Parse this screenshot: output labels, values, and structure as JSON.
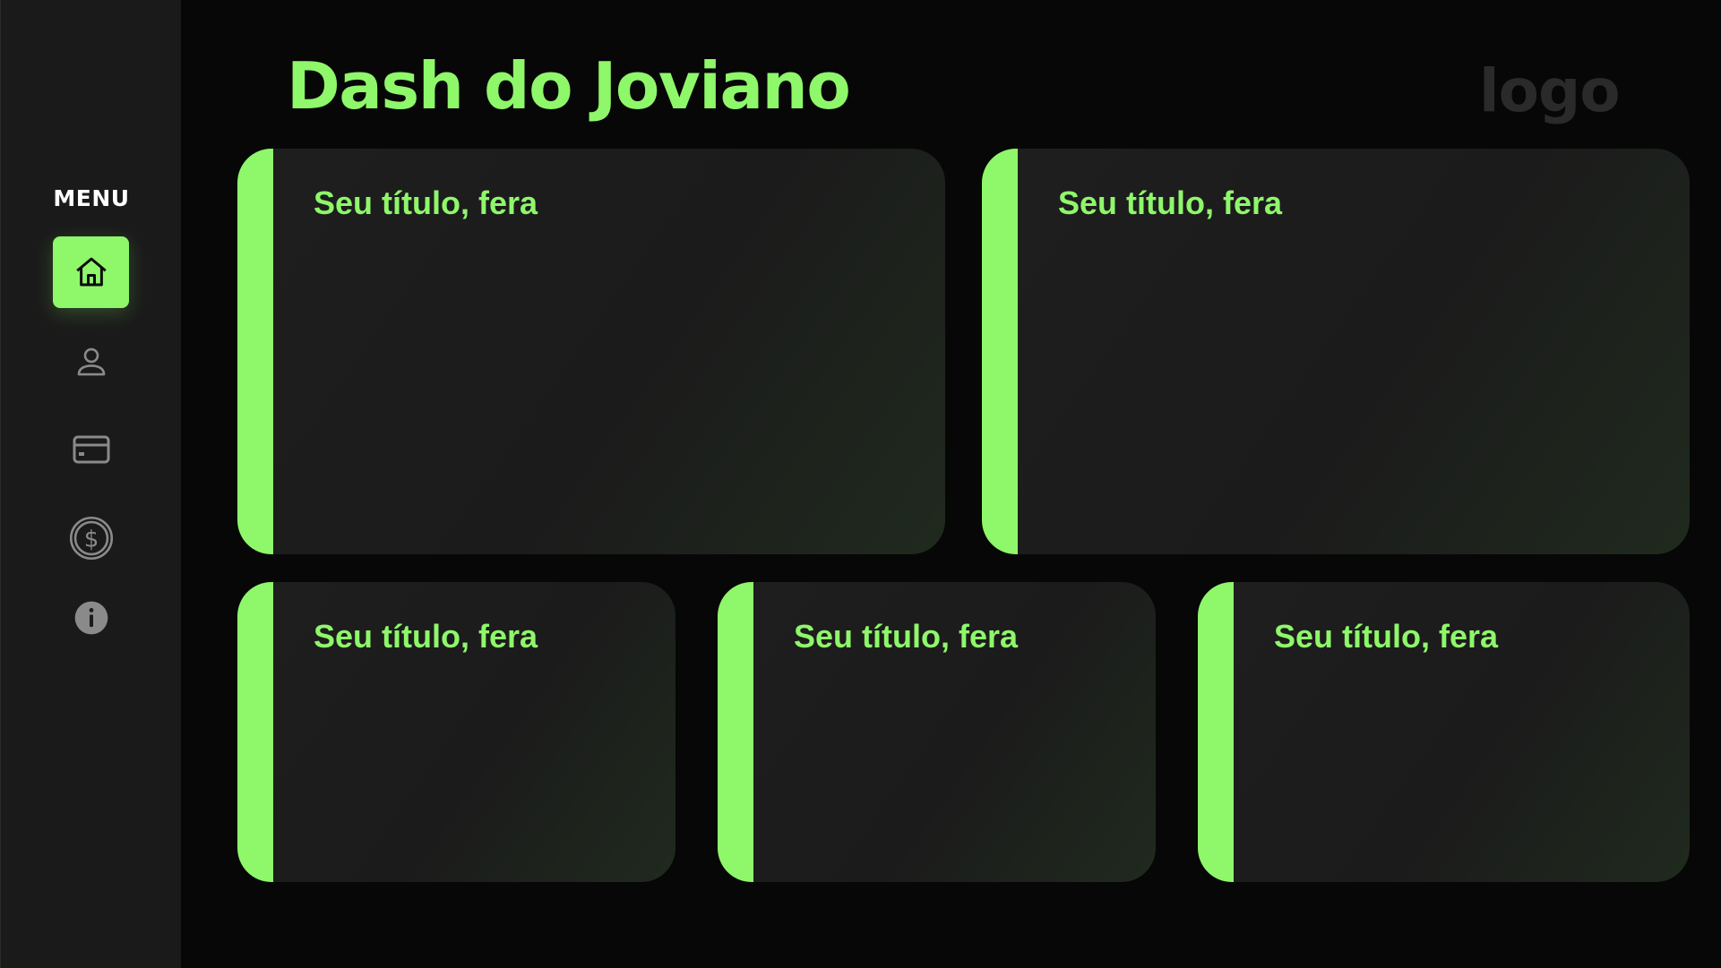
{
  "header": {
    "title": "Dash do Joviano",
    "logo_text": "logo"
  },
  "sidebar": {
    "menu_label": "MENU",
    "items": [
      {
        "icon": "home-icon",
        "active": true
      },
      {
        "icon": "user-icon",
        "active": false
      },
      {
        "icon": "credit-card-icon",
        "active": false
      },
      {
        "icon": "dollar-icon",
        "active": false
      },
      {
        "icon": "info-icon",
        "active": false
      }
    ]
  },
  "cards": [
    {
      "title": "Seu título, fera"
    },
    {
      "title": "Seu título, fera"
    },
    {
      "title": "Seu título, fera"
    },
    {
      "title": "Seu título, fera"
    },
    {
      "title": "Seu título, fera"
    }
  ],
  "colors": {
    "accent": "#8ef76a",
    "background": "#070707",
    "sidebar": "#1a1a1a",
    "card": "#1e1e1e",
    "logo": "#2a2a2a"
  }
}
